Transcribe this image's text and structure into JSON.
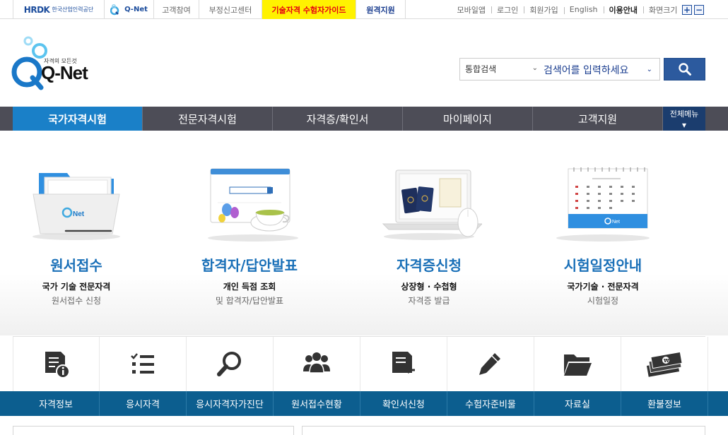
{
  "topbar": {
    "hrdk_mark": "HRDK",
    "hrdk_name": "한국산업인력공단",
    "qnet_mark": "Q-Net",
    "links": [
      "고객참여",
      "부정신고센터",
      "기술자격 수험자가이드",
      "원격지원"
    ],
    "utility": [
      "모바일앱",
      "로그인",
      "회원가입",
      "English",
      "이용안내",
      "화면크기"
    ],
    "zoom_in": "+",
    "zoom_out": "−"
  },
  "header": {
    "logo_tagline": "자격의 모든것",
    "logo_word": "Q-Net",
    "search_scope": "통합검색",
    "search_placeholder": "검색어를 입력하세요",
    "search_icon": "search-icon"
  },
  "gnb": {
    "items": [
      "국가자격시험",
      "전문자격시험",
      "자격증/확인서",
      "마이페이지",
      "고객지원"
    ],
    "all_menu": "전체메뉴",
    "active_index": 0
  },
  "features": [
    {
      "title": "원서접수",
      "sub1": "국가 기술 전문자격",
      "sub2": "원서접수 신청",
      "icon": "folder-illustration"
    },
    {
      "title": "합격자/답안발표",
      "sub1": "개인 득점 조회",
      "sub2": "및 합격자/답안발표",
      "icon": "browser-teacup-illustration"
    },
    {
      "title": "자격증신청",
      "sub1": "상장형 · 수첩형",
      "sub2": "자격증 발급",
      "icon": "laptop-passport-illustration"
    },
    {
      "title": "시험일정안내",
      "sub1": "국가기술 · 전문자격",
      "sub2": "시험일정",
      "icon": "calendar-illustration"
    }
  ],
  "quick_menu": [
    {
      "label": "자격정보",
      "icon": "document-info-icon"
    },
    {
      "label": "응시자격",
      "icon": "checklist-icon"
    },
    {
      "label": "응시자격자가진단",
      "icon": "magnifier-icon"
    },
    {
      "label": "원서접수현황",
      "icon": "people-icon"
    },
    {
      "label": "확인서신청",
      "icon": "document-return-icon"
    },
    {
      "label": "수험자준비물",
      "icon": "pencil-icon"
    },
    {
      "label": "자료실",
      "icon": "folder-icon"
    },
    {
      "label": "환불정보",
      "icon": "money-icon"
    }
  ],
  "colors": {
    "brand_blue": "#1a70b8",
    "nav_dark": "#4d4d57",
    "nav_active": "#1a80c8",
    "quick_bar": "#0c5e8f",
    "highlight_yellow": "#fff200",
    "highlight_red": "#e60012"
  }
}
